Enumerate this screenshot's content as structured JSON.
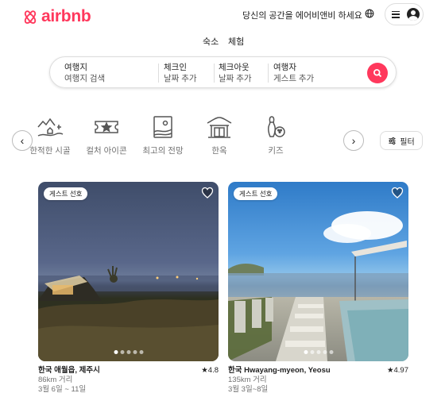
{
  "brand": {
    "name": "airbnb",
    "color": "#ff385c"
  },
  "header": {
    "host_link": "당신의 공간을 에어비앤비 하세요",
    "globe_icon": "globe-icon",
    "menu_icon": "hamburger-menu-icon",
    "avatar_icon": "user-avatar-icon"
  },
  "modes": {
    "stays": "숙소",
    "experiences": "체험"
  },
  "search": {
    "where": {
      "label": "여행지",
      "value": "여행지 검색"
    },
    "checkin": {
      "label": "체크인",
      "value": "날짜 추가"
    },
    "checkout": {
      "label": "체크아웃",
      "value": "날짜 추가"
    },
    "guests": {
      "label": "여행자",
      "value": "게스트 추가"
    },
    "button_icon": "search-icon"
  },
  "categories": [
    {
      "label": "한적한 시골",
      "icon": "countryside-icon"
    },
    {
      "label": "컬처 아이콘",
      "icon": "ticket-star-icon"
    },
    {
      "label": "최고의 전망",
      "icon": "scenic-view-icon"
    },
    {
      "label": "한옥",
      "icon": "hanok-icon"
    },
    {
      "label": "키즈",
      "icon": "bowling-pin-icon"
    }
  ],
  "filter_label": "필터",
  "listings": [
    {
      "badge": "게스트 선호",
      "title": "한국 애월읍, 제주시",
      "rating": "★4.8",
      "distance": "86km 거리",
      "dates": "3월 6일 ~ 11일",
      "photo_count": 5,
      "active_photo": 0
    },
    {
      "badge": "게스트 선호",
      "title": "한국 Hwayang-myeon, Yeosu",
      "rating": "★4.97",
      "distance": "135km 거리",
      "dates": "3월 3일~8일",
      "photo_count": 5,
      "active_photo": 0
    }
  ]
}
